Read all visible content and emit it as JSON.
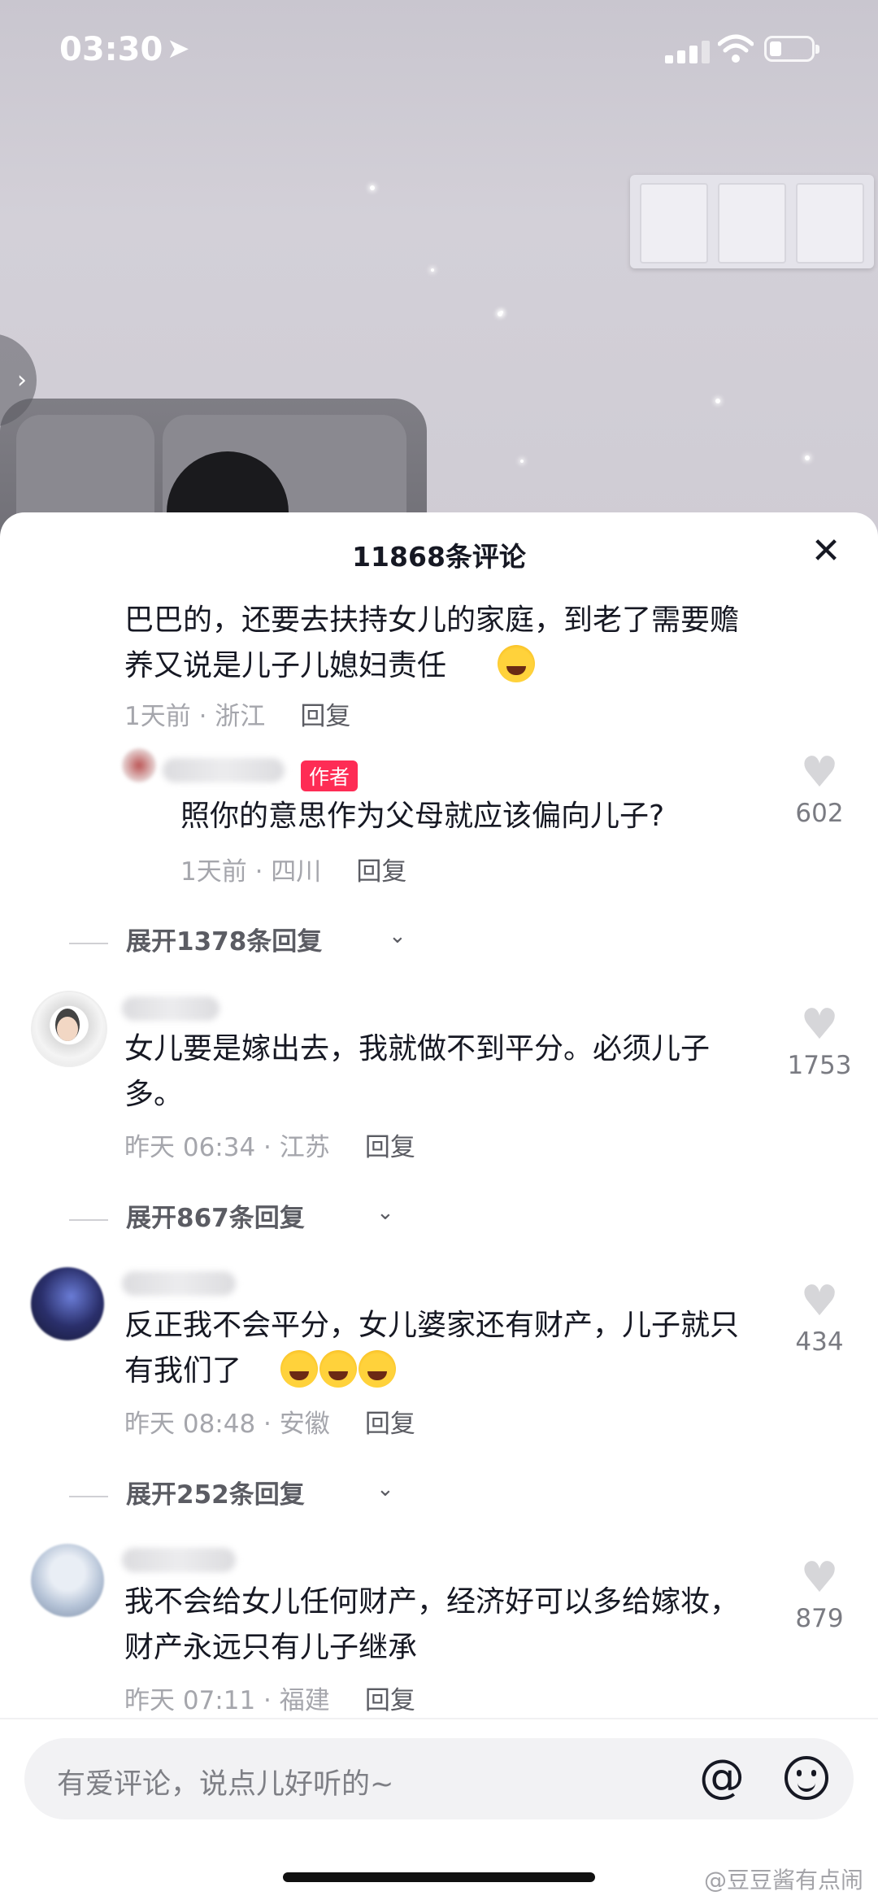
{
  "status_bar": {
    "time": "03:30"
  },
  "sheet": {
    "title": "11868条评论"
  },
  "comments": [
    {
      "text": "巴巴的，还要去扶持女儿的家庭，到老了需要赡养又说是儿子儿媳妇责任",
      "time_location": "1天前 · 浙江",
      "reply_label": "回复"
    },
    {
      "author_tag": "作者",
      "text": "照你的意思作为父母就应该偏向儿子?",
      "time_location": "1天前 · 四川",
      "reply_label": "回复",
      "likes": "602"
    },
    {
      "text": "女儿要是嫁出去，我就做不到平分。必须儿子多。",
      "time_location": "昨天 06:34 · 江苏",
      "reply_label": "回复",
      "likes": "1753"
    },
    {
      "text": "反正我不会平分，女儿婆家还有财产，儿子就只有我们了",
      "time_location": "昨天 08:48 · 安徽",
      "reply_label": "回复",
      "likes": "434"
    },
    {
      "text": "我不会给女儿任何财产，经济好可以多给嫁妆，财产永远只有儿子继承",
      "time_location": "昨天 07:11 · 福建",
      "reply_label": "回复",
      "likes": "879"
    }
  ],
  "expand_labels": [
    "展开1378条回复",
    "展开867条回复",
    "展开252条回复"
  ],
  "input": {
    "placeholder": "有爱评论，说点儿好听的~"
  },
  "watermark": "@豆豆酱有点闹",
  "colors": {
    "author_tag": "#fe2c55",
    "text": "#161823",
    "meta": "#a5a6ac"
  },
  "icons": [
    "location-arrow-icon",
    "signal-icon",
    "wifi-icon",
    "battery-icon",
    "close-icon",
    "heart-icon",
    "at-icon",
    "emoji-icon",
    "laugh-cry-emoji"
  ]
}
